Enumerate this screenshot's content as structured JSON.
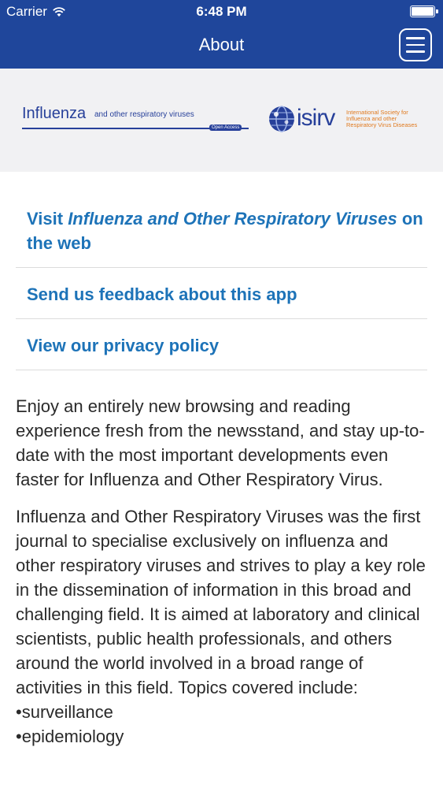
{
  "status_bar": {
    "carrier": "Carrier",
    "time": "6:48 PM"
  },
  "nav": {
    "title": "About",
    "menu_icon": "hamburger-menu-icon"
  },
  "banner": {
    "journal_logo": {
      "name": "Influenza",
      "subtitle": "and other respiratory viruses",
      "badge": "Open Access"
    },
    "isirv_logo": {
      "word": "isirv",
      "tagline": "International Society for Influenza and other Respiratory Virus Diseases"
    }
  },
  "links": {
    "visit_prefix": "Visit ",
    "visit_italic": "Influenza and Other Respiratory Viruses",
    "visit_suffix": " on the web",
    "feedback": "Send us feedback about this app",
    "privacy": "View our privacy policy"
  },
  "body": {
    "paragraph_1": "Enjoy an entirely new browsing and reading experience fresh from the newsstand, and stay up-to-date with the most important developments even faster for Influenza and Other Respiratory Virus.",
    "paragraph_2": "Influenza and Other Respiratory Viruses was the first journal to specialise exclusively on influenza and other respiratory viruses and strives to play a key role in the dissemination of information in this broad and challenging field. It is aimed at laboratory and clinical scientists, public health professionals, and others around the world involved in a broad range of activities in this field.  Topics covered  include:",
    "topics": [
      "surveillance",
      "epidemiology"
    ]
  },
  "colors": {
    "header_bg": "#1f469b",
    "link": "#1d73b8",
    "banner_bg": "#f1f1f3",
    "isirv_orange": "#e07a1f"
  }
}
